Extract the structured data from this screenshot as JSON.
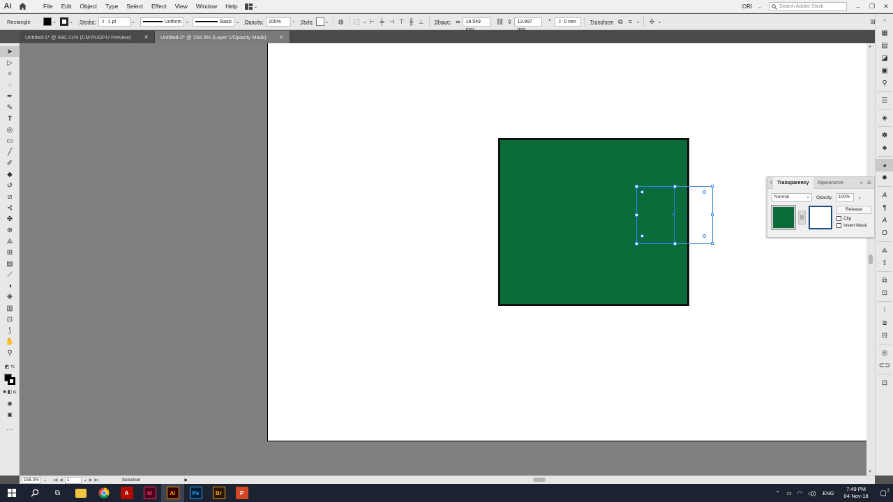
{
  "app": {
    "logo": "Ai",
    "menus": [
      "File",
      "Edit",
      "Object",
      "Type",
      "Select",
      "Effect",
      "View",
      "Window",
      "Help"
    ],
    "user": "ORI",
    "search_placeholder": "Search Adobe Stock"
  },
  "control_bar": {
    "tool_name": "Rectangle",
    "stroke_label": "Stroke:",
    "stroke_value": "1 pt",
    "stroke_profile": "Uniform",
    "brush": "Basic",
    "opacity_label": "Opacity:",
    "opacity_value": "100%",
    "style_label": "Style:",
    "shape_label": "Shape:",
    "width_value": "18.549 mm",
    "height_value": "13.997 mm",
    "corner_value": "0 mm",
    "transform_label": "Transform",
    "fill_color": "#000000"
  },
  "tabs": [
    {
      "title": "Untitled-1* @ 690.71% (CMYK/GPU Preview)"
    },
    {
      "title": "Untitled-2* @ 158.3% (Layer 1/Opacity Mask)"
    }
  ],
  "artwork": {
    "rect_fill": "#0c6b3a",
    "rect_stroke": "#111111"
  },
  "transparency_panel": {
    "tab_active": "Transparency",
    "tab_other": "Appearance",
    "blend_mode": "Normal",
    "opacity_label": "Opacity:",
    "opacity_value": "100%",
    "release_button": "Release",
    "clip_label": "Clip",
    "invert_mask_label": "Invert Mask"
  },
  "status_bar": {
    "zoom": "158.3%",
    "artboard": "1",
    "tool": "Selection"
  },
  "taskbar": {
    "apps": [
      "File Explorer",
      "Chrome",
      "Acrobat",
      "InDesign",
      "Illustrator",
      "Photoshop",
      "Bridge",
      "PowerPoint"
    ],
    "app_labels": {
      "acrobat": "A",
      "indesign": "Id",
      "illustrator": "Ai",
      "photoshop": "Ps",
      "bridge": "Br",
      "powerpoint": "P"
    },
    "language": "ENG",
    "time": "7:49 PM",
    "date": "04-Nov-18",
    "notifications": "2"
  }
}
